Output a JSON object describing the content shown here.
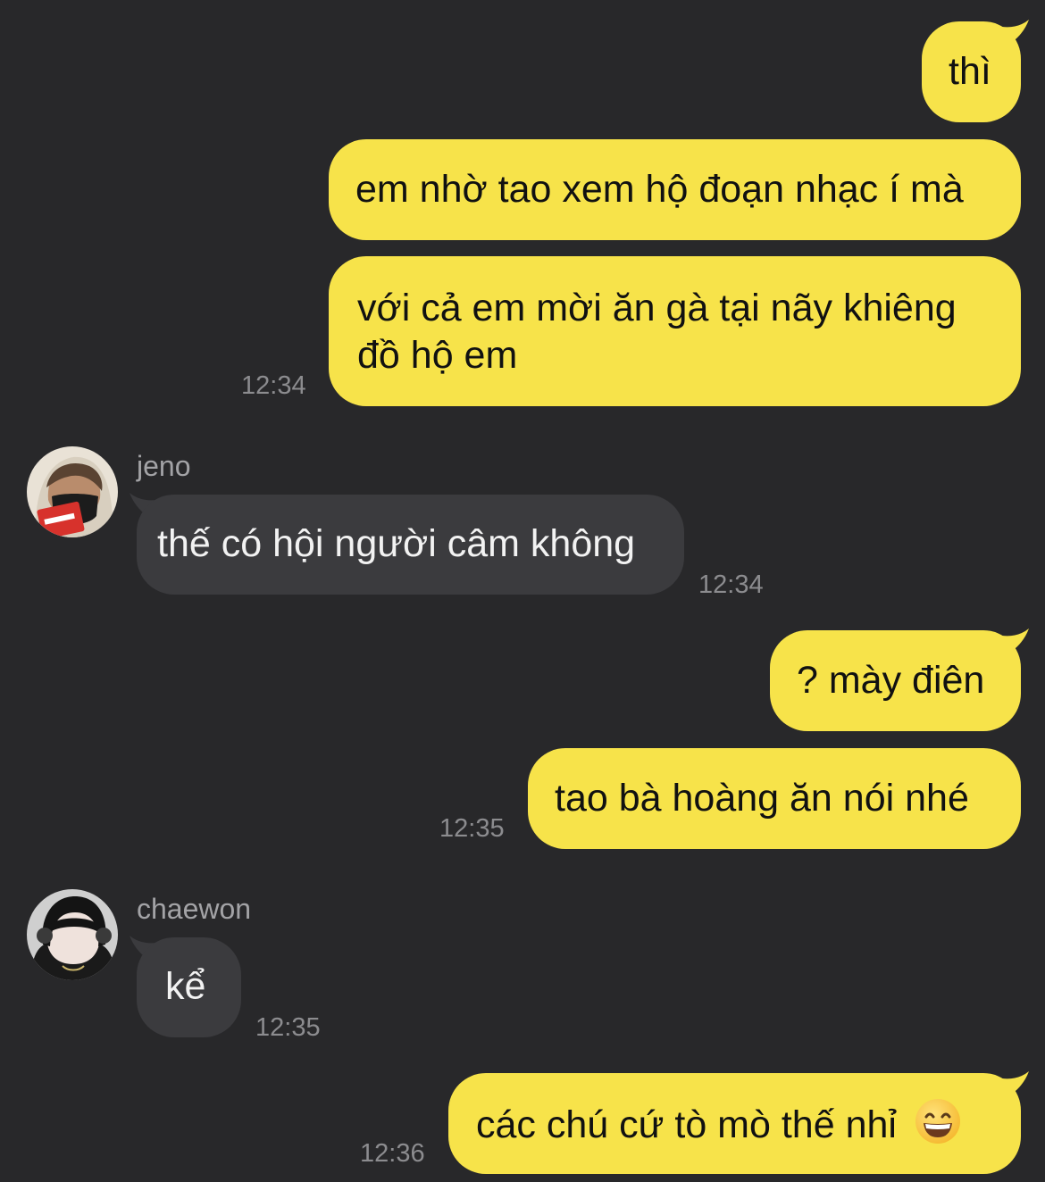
{
  "messages": [
    {
      "text": "thì"
    },
    {
      "text": "em nhờ tao xem hộ đoạn nhạc í mà"
    },
    {
      "text": "với cả em mời ăn gà tại nãy khiêng đồ hộ em",
      "time": "12:34"
    },
    {
      "sender": "jeno",
      "text": "thế có hội người câm không",
      "time": "12:34"
    },
    {
      "text": "? mày điên"
    },
    {
      "text": "tao bà hoàng ăn nói nhé",
      "time": "12:35"
    },
    {
      "sender": "chaewon",
      "text": "kể",
      "time": "12:35"
    },
    {
      "text": "các chú cứ tò mò thế nhỉ",
      "time": "12:36",
      "emoji": "grinning-face-emoji"
    }
  ],
  "colors": {
    "background": "#28282a",
    "outgoing_bubble": "#f7e34a",
    "incoming_bubble": "#3b3b3e",
    "timestamp": "#8c8c8f"
  }
}
